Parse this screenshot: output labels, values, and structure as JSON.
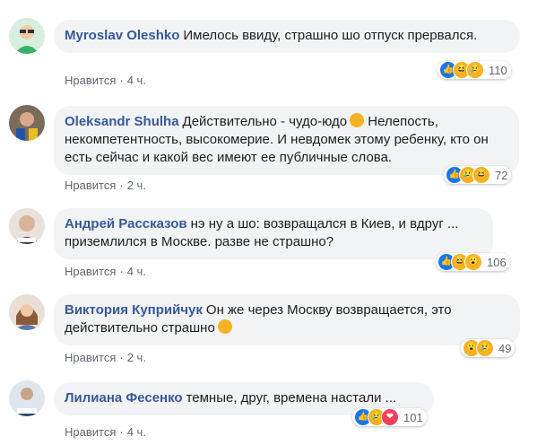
{
  "comments": [
    {
      "author": "Myroslav Oleshko",
      "text": "Имелось ввиду, страшно шо отпуск прервался.",
      "like_label": "Нравится",
      "time": "4 ч.",
      "reactions": [
        "like-icon",
        "laugh-icon",
        "sad-icon"
      ],
      "count": "110",
      "avatar_color": "#3bb06a"
    },
    {
      "author": "Oleksandr Shulha",
      "text": "Действительно - чудо-юдо",
      "text_after": " Нелепость, некомпетентность, высокомерие. И невдомек этому ребенку, кто он есть сейчас и какой вес имеют ее публичные слова.",
      "like_label": "Нравится",
      "time": "2 ч.",
      "reactions": [
        "like-icon",
        "sad-icon",
        "laugh-icon"
      ],
      "count": "72",
      "avatar_color": "#8a6d55"
    },
    {
      "author": "Андрей Рассказов",
      "text": "нэ ну а шо: возвращался в Киев, и вдруг ... приземлился в Москве. разве не страшно?",
      "like_label": "Нравится",
      "time": "4 ч.",
      "reactions": [
        "like-icon",
        "laugh-icon",
        "wow-icon"
      ],
      "count": "106",
      "avatar_color": "#c9b7a6"
    },
    {
      "author": "Виктория Куприйчук",
      "text": "Он же через Москву возвращается, это действительно страшно",
      "like_label": "Нравится",
      "time": "2 ч.",
      "reactions": [
        "wow-icon",
        "sad-icon"
      ],
      "count": "49",
      "avatar_color": "#b58a6a"
    },
    {
      "author": "Лилиана Фесенко",
      "text": "темные, друг, времена настали ...",
      "like_label": "Нравится",
      "time": "4 ч.",
      "reactions": [
        "like-icon",
        "sad-icon",
        "love-icon"
      ],
      "count": "101",
      "avatar_color": "#2f4a6e"
    }
  ],
  "separator": "·"
}
